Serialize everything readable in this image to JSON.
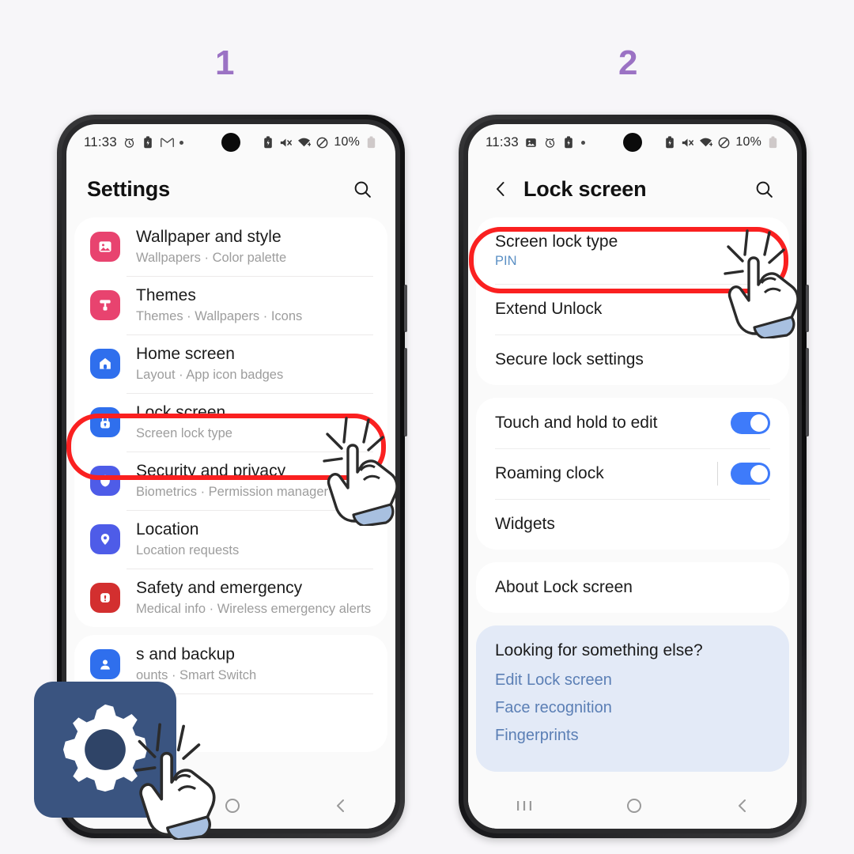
{
  "background_color": "#f7f6f9",
  "accent_colors": {
    "step_number": "#9b72c4",
    "highlight_ring": "#fa2020",
    "toggle_on": "#3e7bfa",
    "link": "#5b7fb5",
    "gear_badge": "#3a5480"
  },
  "steps": [
    {
      "label": "1"
    },
    {
      "label": "2"
    }
  ],
  "phone1": {
    "statusbar": {
      "time": "11:33",
      "left_icons": [
        "alarm-icon",
        "battery-saver-icon",
        "gmail-icon",
        "more-dot-icon"
      ],
      "right_icons": [
        "battery-saver-icon",
        "mute-icon",
        "wifi-icon",
        "do-not-disturb-icon"
      ],
      "battery_percent": "10%"
    },
    "header": {
      "title": "Settings",
      "search_icon": "search-icon"
    },
    "items": [
      {
        "icon": "wallpaper-icon",
        "icon_color": "#e8436f",
        "title": "Wallpaper and style",
        "subtitle": "Wallpapers  ·  Color palette"
      },
      {
        "icon": "themes-icon",
        "icon_color": "#e8436f",
        "title": "Themes",
        "subtitle": "Themes  ·  Wallpapers  ·  Icons"
      },
      {
        "icon": "home-icon",
        "icon_color": "#2f6fed",
        "title": "Home screen",
        "subtitle": "Layout  ·  App icon badges"
      },
      {
        "icon": "lock-icon",
        "icon_color": "#2f6fed",
        "title": "Lock screen",
        "subtitle": "Screen lock type",
        "highlighted": true
      },
      {
        "icon": "shield-icon",
        "icon_color": "#4e5ce8",
        "title": "Security and privacy",
        "subtitle": "Biometrics  ·  Permission manager"
      },
      {
        "icon": "location-pin-icon",
        "icon_color": "#4e5ce8",
        "title": "Location",
        "subtitle": "Location requests"
      },
      {
        "icon": "warning-icon",
        "icon_color": "#d32f2f",
        "title": "Safety and emergency",
        "subtitle": "Medical info  ·  Wireless emergency alerts"
      },
      {
        "icon": "accounts-icon",
        "icon_color": "#2f6fed",
        "title": "s and backup",
        "subtitle": "ounts  ·  Smart Switch"
      }
    ],
    "navbar": [
      "recents-icon",
      "home-icon",
      "back-icon"
    ],
    "gear_badge": {
      "icon": "gear-icon",
      "hand": "tap-hand-icon"
    }
  },
  "phone2": {
    "statusbar": {
      "time": "11:33",
      "left_icons": [
        "screenshot-icon",
        "alarm-icon",
        "battery-saver-icon",
        "more-dot-icon"
      ],
      "right_icons": [
        "battery-saver-icon",
        "mute-icon",
        "wifi-icon",
        "do-not-disturb-icon"
      ],
      "battery_percent": "10%"
    },
    "header": {
      "back_icon": "back-chevron-icon",
      "title": "Lock screen",
      "search_icon": "search-icon"
    },
    "group1": [
      {
        "title": "Screen lock type",
        "value": "PIN",
        "highlighted": true
      },
      {
        "title": "Extend Unlock"
      },
      {
        "title": "Secure lock settings"
      }
    ],
    "group2": [
      {
        "title": "Touch and hold to edit",
        "toggle": "on"
      },
      {
        "title": "Roaming clock",
        "toggle": "on",
        "divider": true
      },
      {
        "title": "Widgets"
      }
    ],
    "group3": [
      {
        "title": "About Lock screen"
      }
    ],
    "suggestion": {
      "title": "Looking for something else?",
      "links": [
        "Edit Lock screen",
        "Face recognition",
        "Fingerprints"
      ]
    },
    "navbar": [
      "recents-icon",
      "home-icon",
      "back-icon"
    ]
  }
}
